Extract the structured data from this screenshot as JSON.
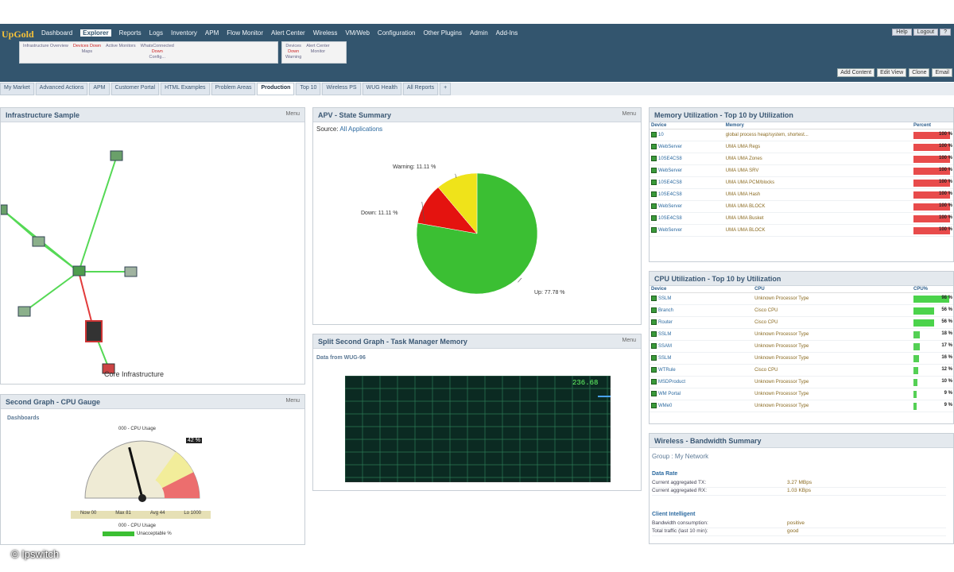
{
  "app": {
    "logo": "UpGold"
  },
  "main_nav": [
    "Dashboard",
    "Explorer",
    "Reports",
    "Logs",
    "Inventory",
    "APM",
    "Flow Monitor",
    "Alert Center",
    "Wireless",
    "VM/Web",
    "Configuration",
    "Other Plugins",
    "Admin",
    "Add-Ins"
  ],
  "main_nav_active": 1,
  "window_buttons": [
    "Help",
    "Logout",
    "?"
  ],
  "sub_panels": [
    {
      "groups": [
        {
          "lines": [
            "Infrastructure Overview"
          ]
        },
        {
          "lines": [
            "Devices Down",
            "Maps"
          ]
        },
        {
          "lines": [
            "Active Monitors"
          ]
        },
        {
          "lines": [
            "WhatsConnected",
            "Down",
            "Config..."
          ]
        }
      ]
    },
    {
      "groups": [
        {
          "lines": [
            "Devices",
            "Down",
            "Warning"
          ]
        },
        {
          "lines": [
            "Alert Center",
            "Monitor"
          ]
        }
      ]
    }
  ],
  "toolbar_buttons": [
    "Add Content",
    "Edit View",
    "Clone",
    "Email"
  ],
  "tabs": [
    "My Market",
    "Advanced Actions",
    "APM",
    "Customer Portal",
    "HTML Examples",
    "Problem Areas",
    "Production",
    "Top 10",
    "Wireless PS",
    "WUG Health",
    "All Reports",
    "+"
  ],
  "active_tab": 6,
  "panels": {
    "infra": {
      "title": "Infrastructure Sample",
      "menu": "Menu",
      "caption": "Core Infrastructure"
    },
    "apm": {
      "title": "APV - State Summary",
      "menu": "Menu",
      "source_label": "Source:",
      "source_value": "All Applications",
      "slices": [
        {
          "label": "Up: 77.78 %",
          "value": 77.78,
          "color": "#3bbf33"
        },
        {
          "label": "Down: 11.11 %",
          "value": 11.11,
          "color": "#e4130f"
        },
        {
          "label": "Warning: 11.11 %",
          "value": 11.11,
          "color": "#efe31a"
        }
      ]
    },
    "split": {
      "title": "Split Second Graph - Task Manager Memory",
      "menu": "Menu",
      "subtitle": "Data from WUG-96",
      "readout": "236.68"
    },
    "gauge": {
      "title": "Second Graph - CPU Gauge",
      "menu": "Menu",
      "device_label": "Dashboards",
      "dial_title": "000 - CPU Usage",
      "value_label": "42 %",
      "value": 42,
      "stats": [
        "Now 00",
        "Max 81",
        "Avg 44",
        "Lo 1000"
      ],
      "footer": "000 - CPU Usage",
      "legend_item": "Unacceptable %"
    },
    "memory": {
      "title": "Memory Utilization - Top 10 by Utilization",
      "headers": [
        "Device",
        "Memory",
        "Percent"
      ],
      "rows": [
        {
          "device": "10",
          "memory": "global process heap/system, shortest...",
          "pct": 100
        },
        {
          "device": "WebServer",
          "memory": "UMA UMA Regs",
          "pct": 100
        },
        {
          "device": "10SE4CS8",
          "memory": "UMA UMA Zones",
          "pct": 100
        },
        {
          "device": "WebServer",
          "memory": "UMA UMA SRV",
          "pct": 100
        },
        {
          "device": "10SE4CS8",
          "memory": "UMA UMA PCM/blocks",
          "pct": 100
        },
        {
          "device": "10SE4CS8",
          "memory": "UMA UMA Hash",
          "pct": 100
        },
        {
          "device": "WebServer",
          "memory": "UMA UMA BLOCK",
          "pct": 100
        },
        {
          "device": "10SE4CS8",
          "memory": "UMA UMA Busket",
          "pct": 100
        },
        {
          "device": "WebServer",
          "memory": "UMA UMA BLOCK",
          "pct": 100
        }
      ]
    },
    "cpu": {
      "title": "CPU Utilization - Top 10 by Utilization",
      "headers": [
        "Device",
        "CPU",
        "CPU%"
      ],
      "rows": [
        {
          "device": "SSLM",
          "cpu": "Unknown Processor Type",
          "pct": 98
        },
        {
          "device": "Branch",
          "cpu": "Cisco CPU",
          "pct": 56
        },
        {
          "device": "Router",
          "cpu": "Cisco CPU",
          "pct": 56
        },
        {
          "device": "SSLM",
          "cpu": "Unknown Processor Type",
          "pct": 18
        },
        {
          "device": "SSAM",
          "cpu": "Unknown Processor Type",
          "pct": 17
        },
        {
          "device": "SSLM",
          "cpu": "Unknown Processor Type",
          "pct": 16
        },
        {
          "device": "WTRule",
          "cpu": "Cisco CPU",
          "pct": 12
        },
        {
          "device": "MSDProduct",
          "cpu": "Unknown Processor Type",
          "pct": 10
        },
        {
          "device": "WM Portal",
          "cpu": "Unknown Processor Type",
          "pct": 9
        },
        {
          "device": "WMe0",
          "cpu": "Unknown Processor Type",
          "pct": 9
        }
      ]
    },
    "wireless": {
      "title": "Wireless - Bandwidth Summary",
      "group": "Group : My Network",
      "sec1": "Data Rate",
      "rows1": [
        {
          "k": "Current aggregated TX:",
          "v": "3.27 MBps"
        },
        {
          "k": "Current aggregated RX:",
          "v": "1.03 KBps"
        }
      ],
      "sec2": "Client Intelligent",
      "rows2": [
        {
          "k": "Bandwidth consumption:",
          "v": "positive"
        },
        {
          "k": "Total traffic (last 10 min):",
          "v": "good"
        }
      ]
    }
  },
  "watermark": "© Ipswitch"
}
